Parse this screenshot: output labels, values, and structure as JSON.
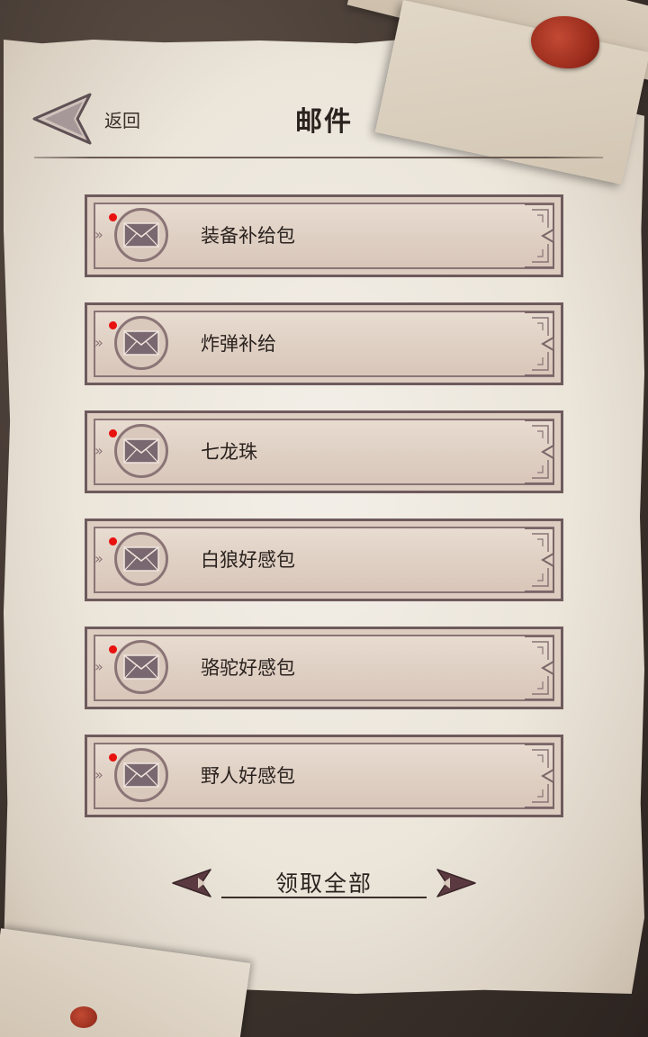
{
  "header": {
    "back_label": "返回",
    "title": "邮件"
  },
  "mails": [
    {
      "title": "装备补给包",
      "unread": true
    },
    {
      "title": "炸弹补给",
      "unread": true
    },
    {
      "title": "七龙珠",
      "unread": true
    },
    {
      "title": "白狼好感包",
      "unread": true
    },
    {
      "title": "骆驼好感包",
      "unread": true
    },
    {
      "title": "野人好感包",
      "unread": true
    }
  ],
  "claim_all_label": "领取全部",
  "colors": {
    "unread_dot": "#e8110f",
    "frame": "#6e5a5c",
    "text": "#2a221e"
  },
  "icons": {
    "back": "back-arrow-icon",
    "mail": "envelope-icon",
    "claim_left": "arrow-left-icon",
    "claim_right": "arrow-right-icon"
  }
}
